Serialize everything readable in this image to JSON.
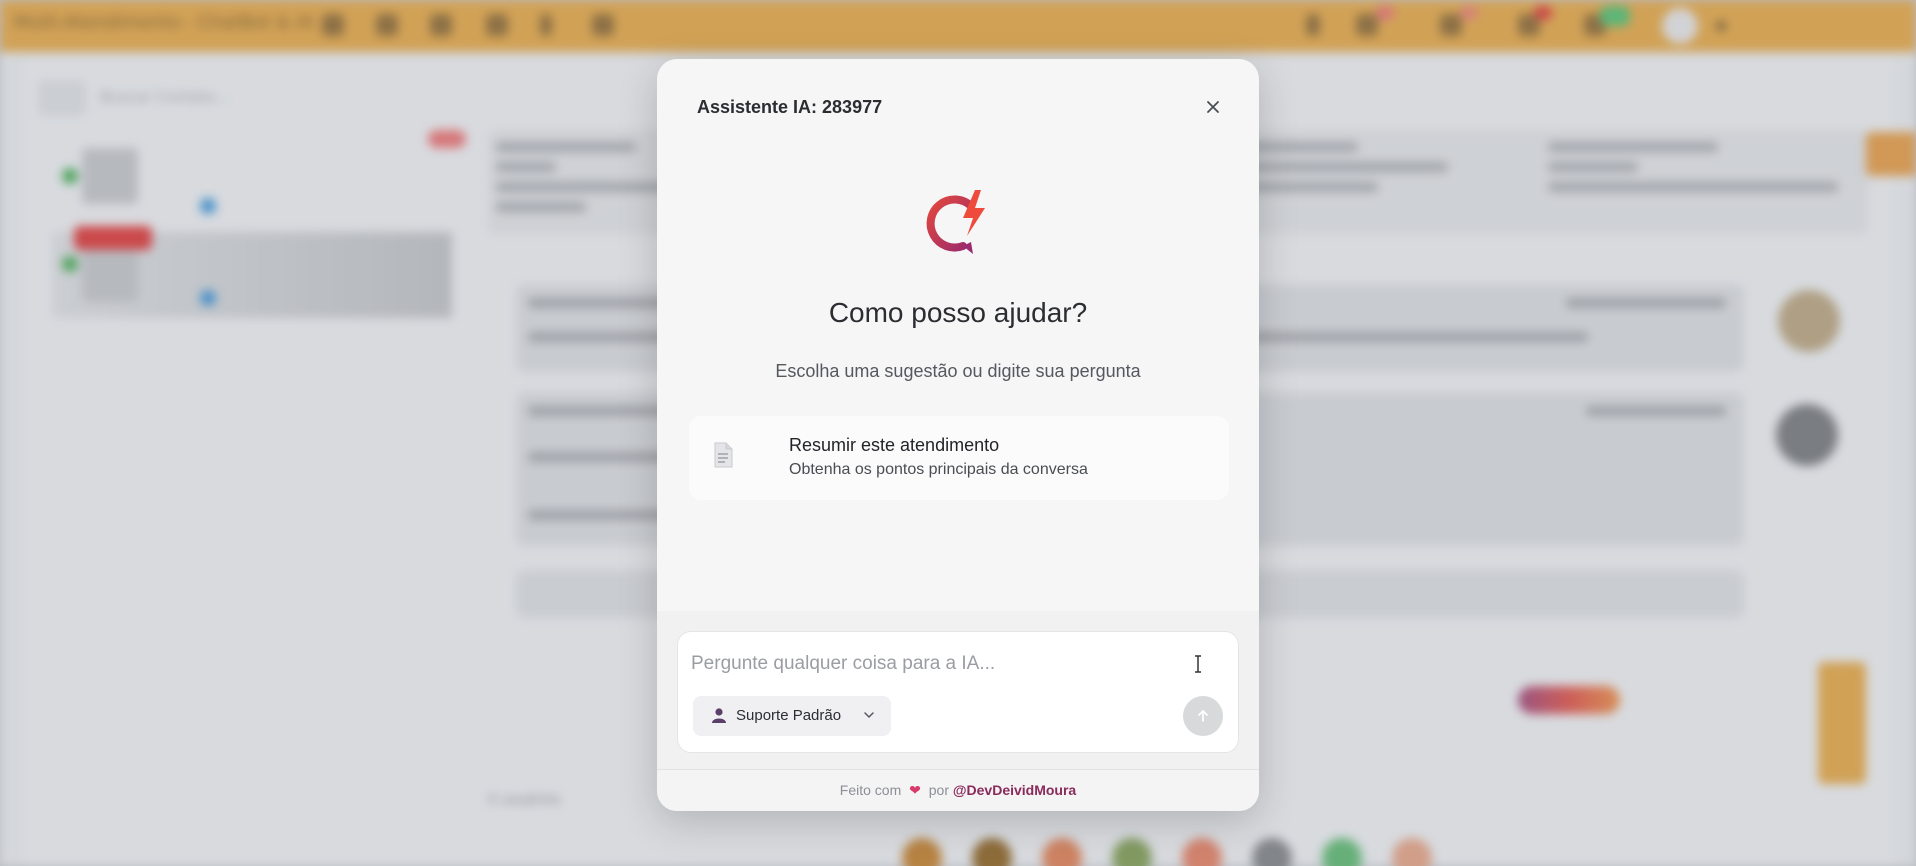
{
  "background_app": {
    "title": "Multi-Atendimento - ChatBot & IA",
    "search_placeholder": "Buscar Contato...",
    "footer_count": "0 usuários",
    "accent_color": "#e8a53a"
  },
  "modal": {
    "title": "Assistente IA: 283977",
    "close_icon": "close-icon",
    "logo_icon": "ai-lightning-logo-icon",
    "heading": "Como posso ajudar?",
    "subheading": "Escolha uma sugestão ou digite sua pergunta",
    "suggestions": [
      {
        "icon": "document-icon",
        "title": "Resumir este atendimento",
        "description": "Obtenha os pontos principais da conversa"
      }
    ],
    "input": {
      "placeholder": "Pergunte qualquer coisa para a IA...",
      "value": ""
    },
    "profile_select": {
      "icon": "user-icon",
      "selected": "Suporte Padrão"
    },
    "send_icon": "arrow-up-icon",
    "footer": {
      "made_with": "Feito com",
      "by": "por",
      "author": "@DevDeividMoura"
    },
    "colors": {
      "brand_gradient_start": "#e2473d",
      "brand_gradient_end": "#9b2a6e",
      "author_color": "#8a2a5a"
    }
  }
}
